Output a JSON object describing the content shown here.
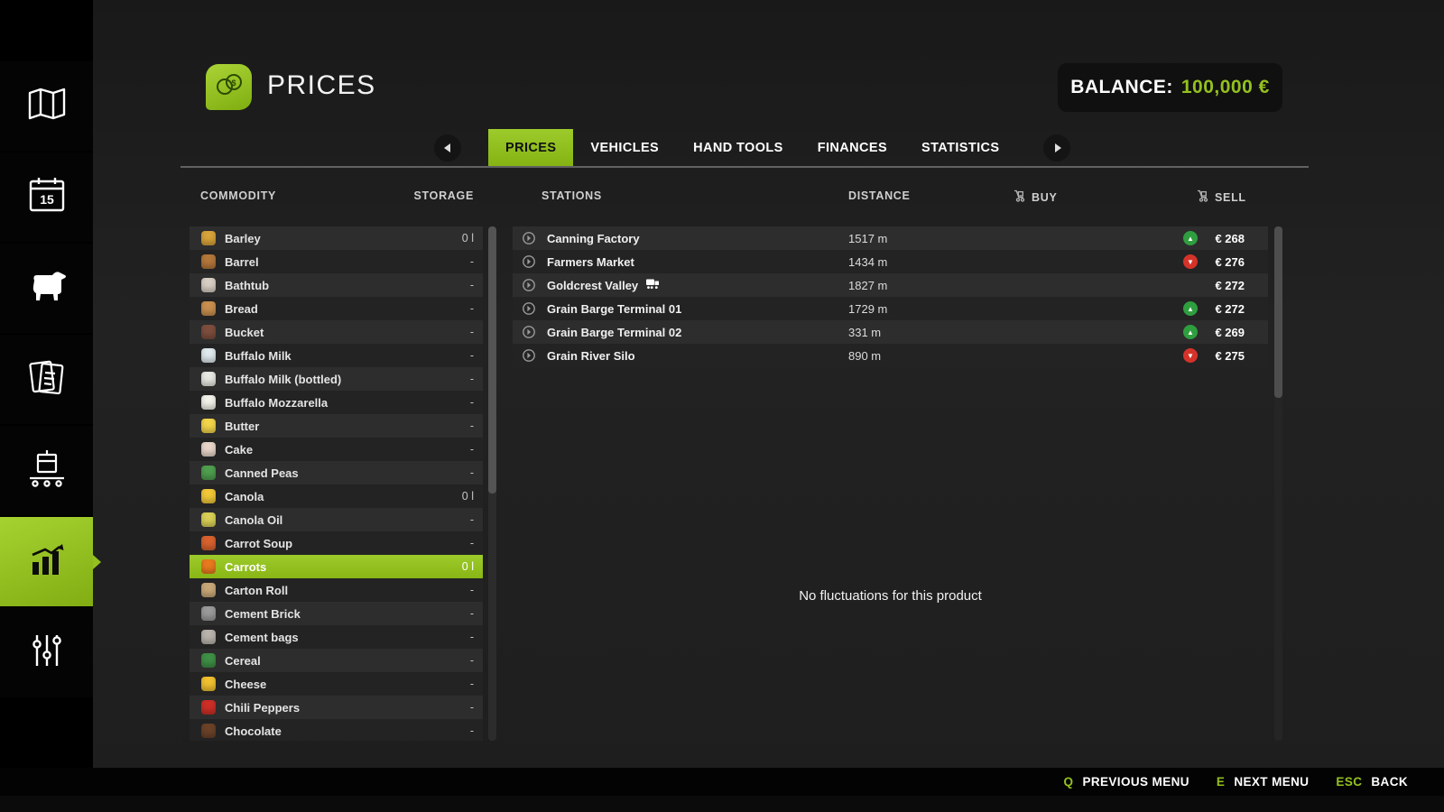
{
  "colors": {
    "accent": "#94c11f",
    "trend_up": "#2f9e3f",
    "trend_down": "#d5332a"
  },
  "header": {
    "title": "PRICES",
    "balance_label": "BALANCE:",
    "balance_value": "100,000 €"
  },
  "tabs": {
    "items": [
      {
        "label": "PRICES",
        "active": true
      },
      {
        "label": "VEHICLES",
        "active": false
      },
      {
        "label": "HAND TOOLS",
        "active": false
      },
      {
        "label": "FINANCES",
        "active": false
      },
      {
        "label": "STATISTICS",
        "active": false
      }
    ]
  },
  "table": {
    "columns": {
      "commodity": "COMMODITY",
      "storage": "STORAGE",
      "stations": "STATIONS",
      "distance": "DISTANCE",
      "buy": "BUY",
      "sell": "SELL"
    }
  },
  "commodities": [
    {
      "name": "Barley",
      "storage": "0 l",
      "icon": "barley-icon",
      "icon_color": "#d8a33a",
      "selected": false
    },
    {
      "name": "Barrel",
      "storage": "-",
      "icon": "barrel-icon",
      "icon_color": "#b4773a",
      "selected": false
    },
    {
      "name": "Bathtub",
      "storage": "-",
      "icon": "bathtub-icon",
      "icon_color": "#d8cfc4",
      "selected": false
    },
    {
      "name": "Bread",
      "storage": "-",
      "icon": "bread-icon",
      "icon_color": "#c98f4e",
      "selected": false
    },
    {
      "name": "Bucket",
      "storage": "-",
      "icon": "bucket-icon",
      "icon_color": "#7d4e3e",
      "selected": false
    },
    {
      "name": "Buffalo Milk",
      "storage": "-",
      "icon": "buffalo-milk-icon",
      "icon_color": "#dfe9ee",
      "selected": false
    },
    {
      "name": "Buffalo Milk (bottled)",
      "storage": "-",
      "icon": "buffalo-milk-bottled-icon",
      "icon_color": "#e8e8e2",
      "selected": false
    },
    {
      "name": "Buffalo Mozzarella",
      "storage": "-",
      "icon": "buffalo-mozzarella-icon",
      "icon_color": "#f2f2ea",
      "selected": false
    },
    {
      "name": "Butter",
      "storage": "-",
      "icon": "butter-icon",
      "icon_color": "#f2d54a",
      "selected": false
    },
    {
      "name": "Cake",
      "storage": "-",
      "icon": "cake-icon",
      "icon_color": "#e8d5c8",
      "selected": false
    },
    {
      "name": "Canned Peas",
      "storage": "-",
      "icon": "canned-peas-icon",
      "icon_color": "#4f9e4f",
      "selected": false
    },
    {
      "name": "Canola",
      "storage": "0 l",
      "icon": "canola-icon",
      "icon_color": "#f0c838",
      "selected": false
    },
    {
      "name": "Canola Oil",
      "storage": "-",
      "icon": "canola-oil-icon",
      "icon_color": "#d9cf56",
      "selected": false
    },
    {
      "name": "Carrot Soup",
      "storage": "-",
      "icon": "carrot-soup-icon",
      "icon_color": "#d8622e",
      "selected": false
    },
    {
      "name": "Carrots",
      "storage": "0 l",
      "icon": "carrots-icon",
      "icon_color": "#e87a1e",
      "selected": true
    },
    {
      "name": "Carton Roll",
      "storage": "-",
      "icon": "carton-roll-icon",
      "icon_color": "#c8a878",
      "selected": false
    },
    {
      "name": "Cement Brick",
      "storage": "-",
      "icon": "cement-brick-icon",
      "icon_color": "#9a9a9a",
      "selected": false
    },
    {
      "name": "Cement bags",
      "storage": "-",
      "icon": "cement-bags-icon",
      "icon_color": "#b8b4ac",
      "selected": false
    },
    {
      "name": "Cereal",
      "storage": "-",
      "icon": "cereal-icon",
      "icon_color": "#3f8f46",
      "selected": false
    },
    {
      "name": "Cheese",
      "storage": "-",
      "icon": "cheese-icon",
      "icon_color": "#f0c030",
      "selected": false
    },
    {
      "name": "Chili Peppers",
      "storage": "-",
      "icon": "chili-peppers-icon",
      "icon_color": "#cc2f26",
      "selected": false
    },
    {
      "name": "Chocolate",
      "storage": "-",
      "icon": "chocolate-icon",
      "icon_color": "#6b4228",
      "selected": false
    }
  ],
  "stations": [
    {
      "name": "Canning Factory",
      "distance": "1517 m",
      "sell": "€ 268",
      "trend": "up",
      "train": false
    },
    {
      "name": "Farmers Market",
      "distance": "1434 m",
      "sell": "€ 276",
      "trend": "down",
      "train": false
    },
    {
      "name": "Goldcrest Valley",
      "distance": "1827 m",
      "sell": "€ 272",
      "trend": null,
      "train": true
    },
    {
      "name": "Grain Barge Terminal 01",
      "distance": "1729 m",
      "sell": "€ 272",
      "trend": "up",
      "train": false
    },
    {
      "name": "Grain Barge Terminal 02",
      "distance": "331 m",
      "sell": "€ 269",
      "trend": "up",
      "train": false
    },
    {
      "name": "Grain River Silo",
      "distance": "890 m",
      "sell": "€ 275",
      "trend": "down",
      "train": false
    }
  ],
  "fluctuations_message": "No fluctuations for this product",
  "footer": {
    "shortcuts": [
      {
        "key": "Q",
        "label": "PREVIOUS MENU"
      },
      {
        "key": "E",
        "label": "NEXT MENU"
      },
      {
        "key": "ESC",
        "label": "BACK"
      }
    ]
  },
  "sidebar": {
    "icons": [
      "map-icon",
      "calendar-icon",
      "animals-icon",
      "contracts-icon",
      "production-icon",
      "statistics-icon",
      "settings-icon"
    ],
    "active_index": 5
  }
}
